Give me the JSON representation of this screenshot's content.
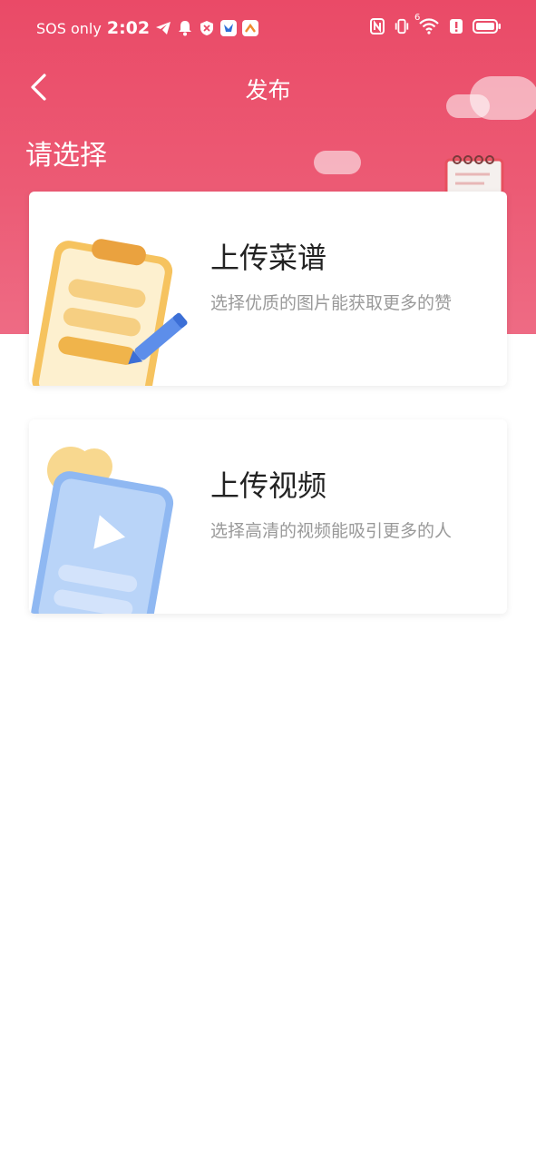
{
  "status_bar": {
    "carrier": "SOS only",
    "time": "2:02",
    "left_icons": [
      "telegram-icon",
      "bell-icon",
      "shield-icon",
      "app-icon-blue",
      "app-icon-orange"
    ],
    "right_icons": [
      "nfc-icon",
      "vibrate-icon",
      "wifi-icon",
      "alert-icon",
      "battery-icon"
    ],
    "wifi_badge": "6"
  },
  "nav": {
    "title": "发布",
    "back_icon": "chevron-left-icon"
  },
  "section": {
    "title": "请选择"
  },
  "cards": [
    {
      "title": "上传菜谱",
      "description": "选择优质的图片能获取更多的赞",
      "icon": "clipboard-pencil-icon"
    },
    {
      "title": "上传视频",
      "description": "选择高清的视频能吸引更多的人",
      "icon": "video-play-icon"
    }
  ],
  "colors": {
    "header_primary": "#ea4a67",
    "header_secondary": "#ee6b84",
    "title_text": "#222222",
    "description_text": "#999999",
    "recipe_accent": "#f5c86a",
    "video_accent": "#8fb8f2"
  }
}
